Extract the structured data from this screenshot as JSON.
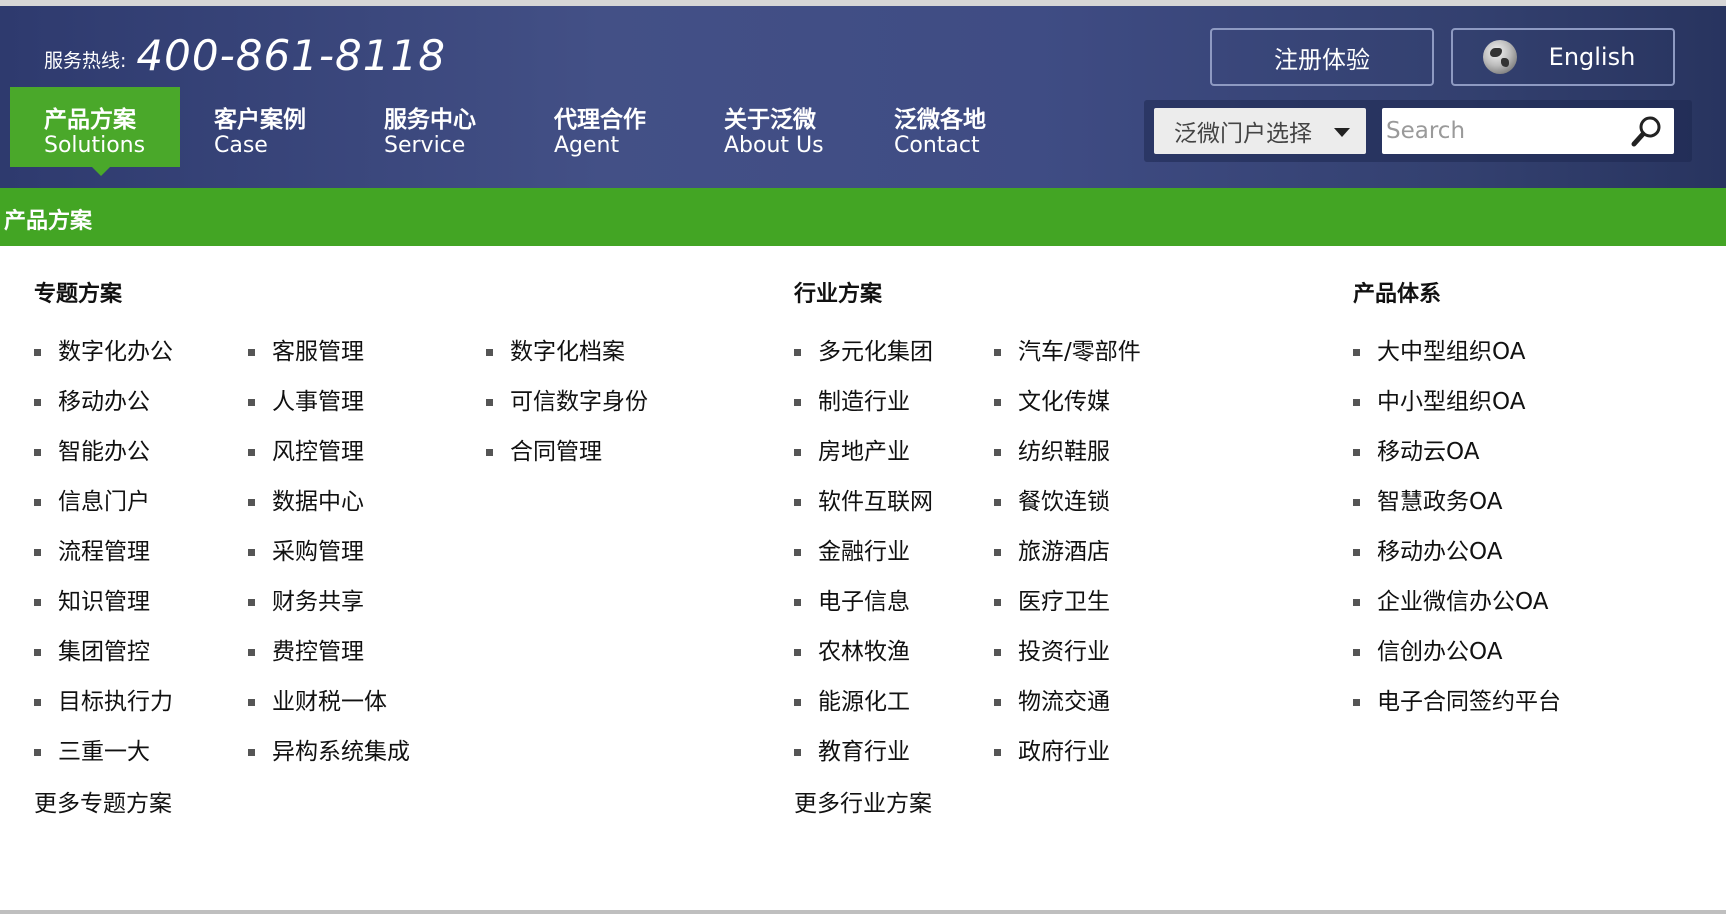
{
  "header": {
    "hotline_label": "服务热线:",
    "hotline_number": "400-861-8118",
    "register_label": "注册体验",
    "english_label": "English"
  },
  "nav": {
    "items": [
      {
        "zh": "产品方案",
        "en": "Solutions",
        "active": true
      },
      {
        "zh": "客户案例",
        "en": "Case"
      },
      {
        "zh": "服务中心",
        "en": "Service"
      },
      {
        "zh": "代理合作",
        "en": "Agent"
      },
      {
        "zh": "关于泛微",
        "en": "About Us"
      },
      {
        "zh": "泛微各地",
        "en": "Contact"
      }
    ]
  },
  "search": {
    "portal_select_value": "泛微门户选择",
    "placeholder": "Search"
  },
  "dropdown": {
    "title": "产品方案",
    "topics": {
      "title": "专题方案",
      "col1": [
        "数字化办公",
        "移动办公",
        "智能办公",
        "信息门户",
        "流程管理",
        "知识管理",
        "集团管控",
        "目标执行力",
        "三重一大"
      ],
      "col2": [
        "客服管理",
        "人事管理",
        "风控管理",
        "数据中心",
        "采购管理",
        "财务共享",
        "费控管理",
        "业财税一体",
        "异构系统集成"
      ],
      "col3": [
        "数字化档案",
        "可信数字身份",
        "合同管理"
      ],
      "more": "更多专题方案"
    },
    "industry": {
      "title": "行业方案",
      "col1": [
        "多元化集团",
        "制造行业",
        "房地产业",
        "软件互联网",
        "金融行业",
        "电子信息",
        "农林牧渔",
        "能源化工",
        "教育行业"
      ],
      "col2": [
        "汽车/零部件",
        "文化传媒",
        "纺织鞋服",
        "餐饮连锁",
        "旅游酒店",
        "医疗卫生",
        "投资行业",
        "物流交通",
        "政府行业"
      ],
      "more": "更多行业方案"
    },
    "products": {
      "title": "产品体系",
      "col1": [
        "大中型组织OA",
        "中小型组织OA",
        "移动云OA",
        "智慧政务OA",
        "移动办公OA",
        "企业微信办公OA",
        "信创办公OA",
        "电子合同签约平台"
      ]
    }
  },
  "colors": {
    "header_bg": "#435086",
    "accent_green": "#43a524"
  }
}
